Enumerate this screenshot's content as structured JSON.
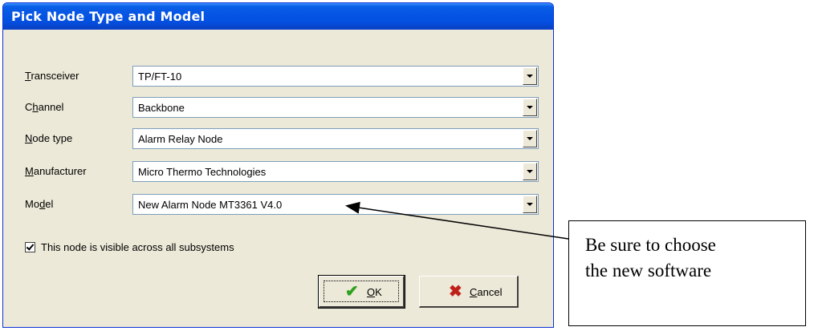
{
  "dialog": {
    "title": "Pick Node Type and Model",
    "fields": [
      {
        "label_pre": "",
        "label_mn": "T",
        "label_post": "ransceiver",
        "value": "TP/FT-10"
      },
      {
        "label_pre": "C",
        "label_mn": "h",
        "label_post": "annel",
        "value": "Backbone"
      },
      {
        "label_pre": "",
        "label_mn": "N",
        "label_post": "ode type",
        "value": "Alarm Relay Node"
      },
      {
        "label_pre": "",
        "label_mn": "M",
        "label_post": "anufacturer",
        "value": "Micro Thermo Technologies"
      },
      {
        "label_pre": "Mo",
        "label_mn": "d",
        "label_post": "el",
        "value": "New Alarm Node MT3361 V4.0"
      }
    ],
    "checkbox": {
      "label": "This node is visible across all subsystems",
      "checked": true
    },
    "buttons": {
      "ok": {
        "mn": "O",
        "rest": "K",
        "icon": "checkmark-icon"
      },
      "cancel": {
        "mn": "C",
        "rest": "ancel",
        "icon": "x-icon"
      }
    }
  },
  "callout": {
    "line1": "Be sure to choose",
    "line2": "the new software"
  },
  "colors": {
    "titlebar": "#0554e3",
    "dialog_bg": "#ece9d8",
    "ok_icon": "#2ea11f",
    "cancel_icon": "#c0201a"
  }
}
